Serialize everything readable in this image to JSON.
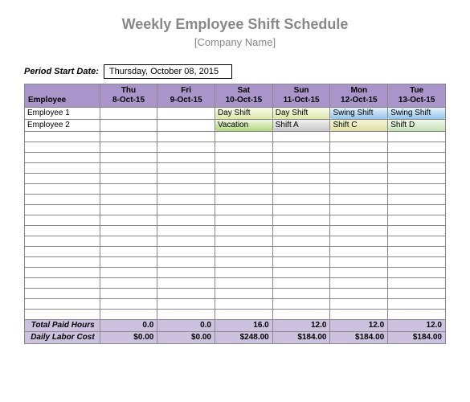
{
  "title": "Weekly Employee Shift Schedule",
  "subtitle": "[Company Name]",
  "period_label": "Period Start Date:",
  "period_value": "Thursday, October 08, 2015",
  "columns": {
    "employee_header": "Employee",
    "days": [
      {
        "dow": "Thu",
        "date": "8-Oct-15"
      },
      {
        "dow": "Fri",
        "date": "9-Oct-15"
      },
      {
        "dow": "Sat",
        "date": "10-Oct-15"
      },
      {
        "dow": "Sun",
        "date": "11-Oct-15"
      },
      {
        "dow": "Mon",
        "date": "12-Oct-15"
      },
      {
        "dow": "Tue",
        "date": "13-Oct-15"
      }
    ]
  },
  "employees": [
    {
      "name": "Employee 1",
      "shifts": [
        "",
        "",
        "Day Shift",
        "Day Shift",
        "Swing Shift",
        "Swing Shift"
      ],
      "shift_class": [
        "",
        "",
        "shift-day",
        "shift-day",
        "shift-swing",
        "shift-swing"
      ]
    },
    {
      "name": "Employee 2",
      "shifts": [
        "",
        "",
        "Vacation",
        "Shift A",
        "Shift C",
        "Shift D"
      ],
      "shift_class": [
        "",
        "",
        "shift-vac",
        "shift-a",
        "shift-c",
        "shift-d"
      ]
    }
  ],
  "empty_rows": 18,
  "totals": {
    "paid_hours_label": "Total Paid Hours",
    "paid_hours": [
      "0.0",
      "0.0",
      "16.0",
      "12.0",
      "12.0",
      "12.0"
    ],
    "labor_cost_label": "Daily Labor Cost",
    "labor_cost": [
      "$0.00",
      "$0.00",
      "$248.00",
      "$184.00",
      "$184.00",
      "$184.00"
    ]
  }
}
